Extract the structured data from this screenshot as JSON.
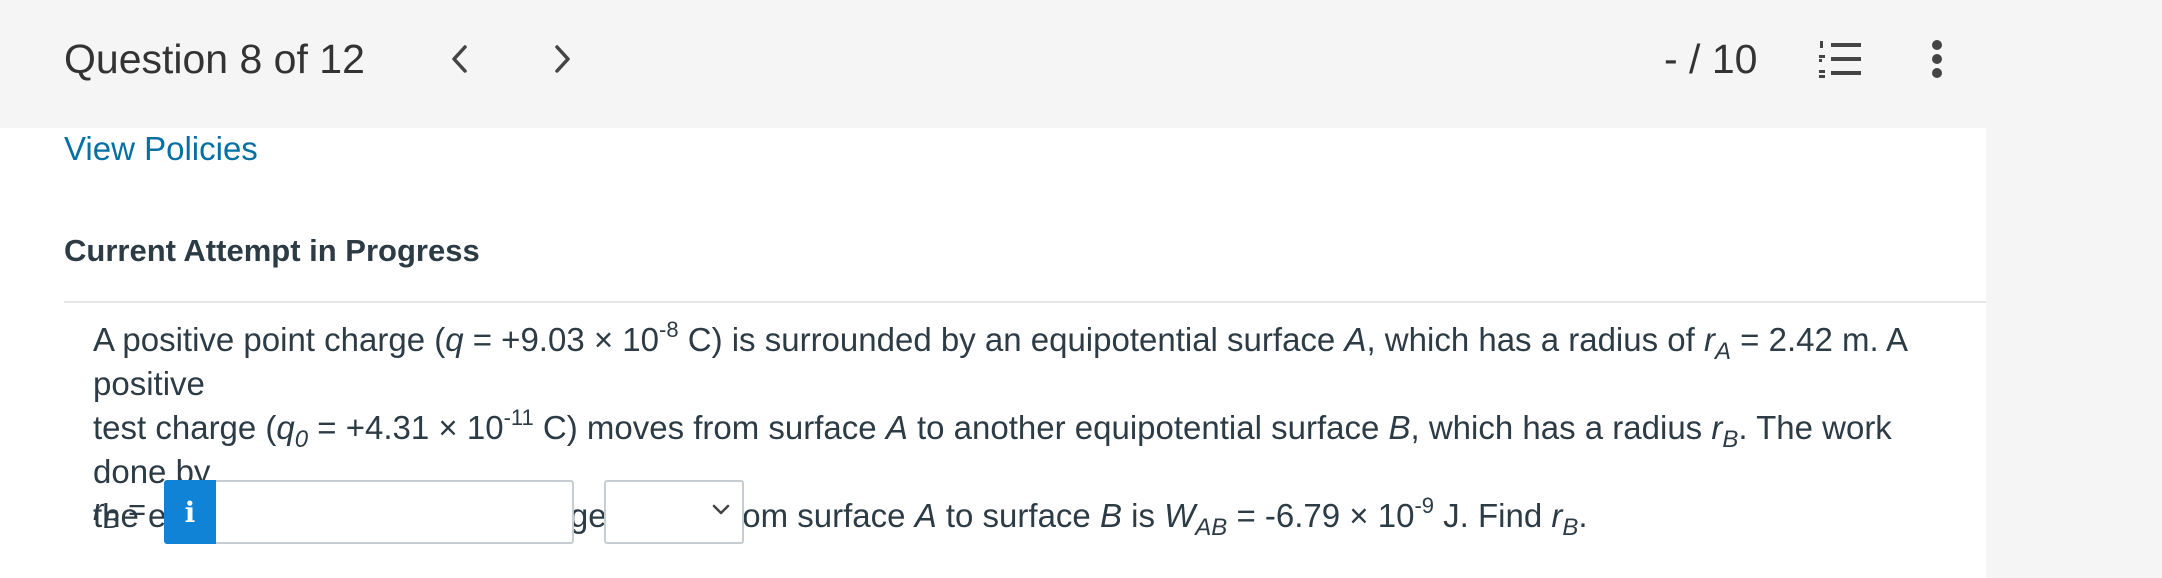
{
  "header": {
    "question_label": "Question 8 of 12",
    "score": "- / 10",
    "icons": {
      "prev": "chevron-left-icon",
      "next": "chevron-right-icon",
      "list": "numbered-list-icon",
      "more": "more-vertical-icon"
    }
  },
  "links": {
    "view_policies": "View Policies"
  },
  "section": {
    "attempt_title": "Current Attempt in Progress"
  },
  "problem": {
    "line1": {
      "t1": "A positive point charge (",
      "q": "q",
      "t2": " = +9.03 × 10",
      "exp_q": "-8",
      "t3": " C) is surrounded by an equipotential surface ",
      "A": "A",
      "t4": ", which has a radius of ",
      "r": "r",
      "sub_A": "A",
      "t5": " = 2.42 m. A positive"
    },
    "line2": {
      "t1": "test charge (",
      "q": "q",
      "sub_0": "0",
      "t2": " = +4.31 × 10",
      "exp_q0": "-11",
      "t3": " C) moves from surface ",
      "A": "A",
      "t4": " to another equipotential surface ",
      "B": "B",
      "t5": ", which has a radius ",
      "r": "r",
      "sub_B": "B",
      "t6": ". The work done by"
    },
    "line3": {
      "t1": "the electric force as the test charge moves from surface ",
      "A": "A",
      "t2": " to surface ",
      "B": "B",
      "t3": " is ",
      "W": "W",
      "sub_AB": "AB",
      "t4": " = -6.79 × 10",
      "exp_W": "-9",
      "t5": " J. Find ",
      "r": "r",
      "sub_B": "B",
      "t6": "."
    }
  },
  "answer": {
    "label_r": "r",
    "label_sub": "B",
    "label_eq": " =",
    "info_glyph": "i",
    "value": "",
    "placeholder": "",
    "unit_selected": ""
  },
  "colors": {
    "header_bg": "#f5f5f5",
    "link": "#0770a3",
    "info_button": "#1083d6",
    "text": "#2d3b45"
  }
}
